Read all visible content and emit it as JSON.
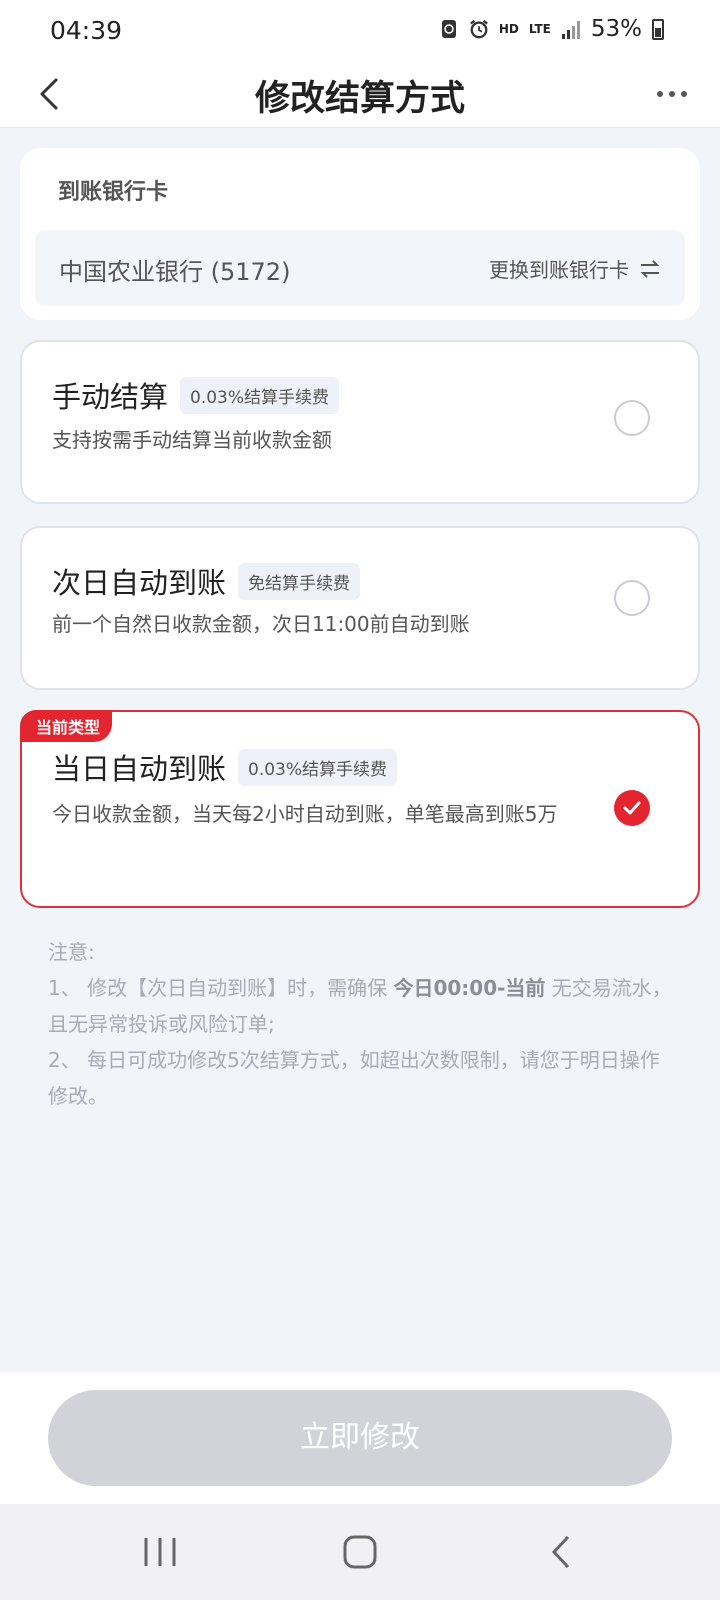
{
  "status_bar": {
    "time": "04:39",
    "hd": "HD",
    "lte": "LTE",
    "battery": "53%"
  },
  "nav": {
    "title": "修改结算方式"
  },
  "bank": {
    "section_title": "到账银行卡",
    "bank_name": "中国农业银行 (5172)",
    "change_label": "更换到账银行卡"
  },
  "options": [
    {
      "title": "手动结算",
      "tag": "0.03%结算手续费",
      "desc": "支持按需手动结算当前收款金额",
      "selected": false
    },
    {
      "title": "次日自动到账",
      "tag": "免结算手续费",
      "desc": "前一个自然日收款金额，次日11:00前自动到账",
      "selected": false
    },
    {
      "title": "当日自动到账",
      "tag": "0.03%结算手续费",
      "desc": "今日收款金额，当天每2小时自动到账，单笔最高到账5万",
      "selected": true,
      "badge": "当前类型"
    }
  ],
  "notes": {
    "heading": "注意:",
    "item1_prefix": "1、 修改【次日自动到账】时，需确保 ",
    "item1_bold": "今日00:00-当前",
    "item1_suffix": " 无交易流水，且无异常投诉或风险订单;",
    "item2": "2、 每日可成功修改5次结算方式，如超出次数限制，请您于明日操作修改。"
  },
  "submit": {
    "label": "立即修改"
  },
  "colors": {
    "accent_red": "#e3252f",
    "page_bg": "#f1f4f9",
    "disabled_button": "#d1d3d9"
  }
}
